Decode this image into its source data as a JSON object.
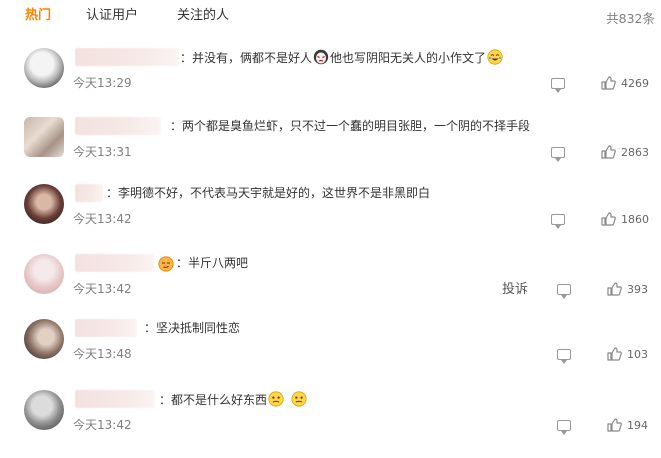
{
  "tabs": [
    {
      "label": "热门",
      "active": true
    },
    {
      "label": "认证用户",
      "active": false
    },
    {
      "label": "关注的人",
      "active": false
    }
  ],
  "total_label": "共832条",
  "accent_color": "#ff8200",
  "comments": [
    {
      "text_before": "：并没有，俩都不是好人",
      "text_after": "他也写阴阳无关人的小作文了",
      "time": "今天13:29",
      "likes": "4269"
    },
    {
      "text": "：两个都是臭鱼烂虾，只不过一个蠢的明目张胆，一个阴的不择手段",
      "time": "今天13:31",
      "likes": "2863"
    },
    {
      "text": "：李明德不好，不代表马天宇就是好的，这世界不是非黑即白",
      "time": "今天13:42",
      "likes": "1860"
    },
    {
      "text": "：半斤八两吧",
      "time": "今天13:42",
      "likes": "393",
      "report_label": "投诉"
    },
    {
      "text": "：坚决抵制同性恋",
      "time": "今天13:48",
      "likes": "103"
    },
    {
      "text": "：都不是什么好东西",
      "time": "今天13:42",
      "likes": "194"
    }
  ]
}
